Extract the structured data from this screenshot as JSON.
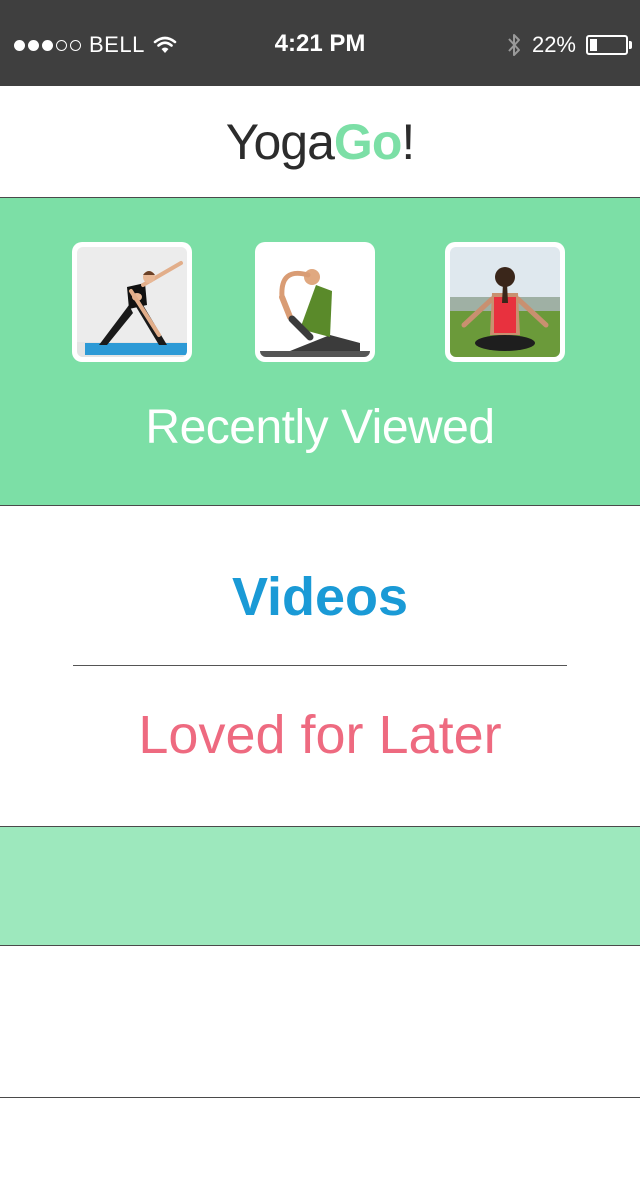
{
  "status_bar": {
    "carrier": "BELL",
    "signal_bars_filled": 3,
    "signal_bars_total": 5,
    "time": "4:21 PM",
    "battery_percent_label": "22%",
    "battery_level": 0.22
  },
  "header": {
    "title_part1": "Yoga",
    "title_part2": "Go",
    "title_part3": "!"
  },
  "recently_viewed": {
    "label": "Recently Viewed",
    "thumbnails": [
      {
        "icon": "yoga-triangle-pose-photo"
      },
      {
        "icon": "yoga-pigeon-pose-photo"
      },
      {
        "icon": "yoga-meditation-pose-photo"
      }
    ]
  },
  "menu": {
    "videos_label": "Videos",
    "loved_label": "Loved for Later"
  },
  "colors": {
    "accent_green": "#7cdfa6",
    "light_green": "#9de8bd",
    "videos_blue": "#1a9ad6",
    "loved_pink": "#ee6a80",
    "status_bar_bg": "#3f3f3f"
  }
}
